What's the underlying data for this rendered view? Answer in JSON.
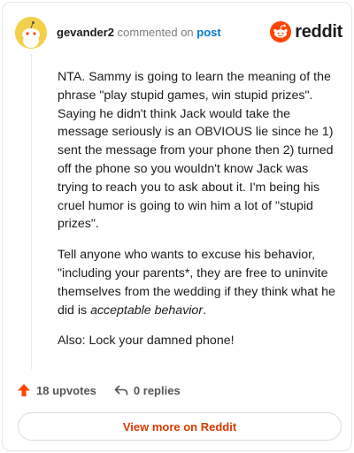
{
  "comment": {
    "username": "gevander2",
    "action_text": "commented on",
    "post_link": "post",
    "paragraphs": [
      "NTA. Sammy is going to learn the meaning of the phrase \"play stupid games, win stupid prizes\". Saying he didn't think Jack would take the message seriously is an OBVIOUS lie since he 1) sent the message from your phone then 2) turned off the phone so you wouldn't know Jack was trying to reach you to ask about it. I'm being his cruel humor is going to win him a lot of \"stupid prizes\".",
      "Also: Lock your damned phone!"
    ],
    "paragraph2_lead": "Tell anyone who wants to excuse his behavior, \"including your parents*, they are free to uninvite themselves from the wedding if they think what he did is ",
    "paragraph2_emphasis": "acceptable behavior",
    "paragraph2_tail": "."
  },
  "brand": {
    "wordmark": "reddit",
    "color": "#ff4500"
  },
  "actions": {
    "upvotes": "18 upvotes",
    "replies": "0 replies",
    "upvote_icon": "upvote-arrow-icon",
    "reply_icon": "reply-arrow-icon"
  },
  "cta": {
    "label": "View more on Reddit"
  },
  "colors": {
    "accent": "#d93a00",
    "link": "#0079d3",
    "avatar": "#f2d04a"
  }
}
